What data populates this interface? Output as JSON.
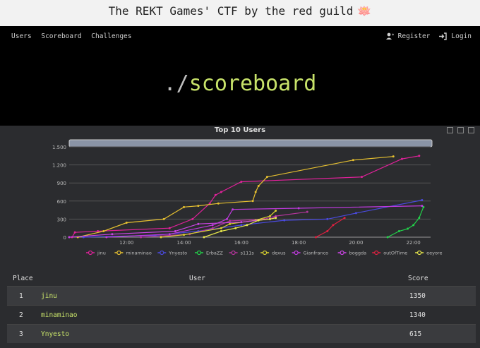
{
  "banner": {
    "title": "The REKT Games' CTF by the red guild",
    "emoji": "🪷"
  },
  "nav": {
    "left": [
      "Users",
      "Scoreboard",
      "Challenges"
    ],
    "register": "Register",
    "login": "Login"
  },
  "hero": {
    "prefix": "./",
    "word": "scoreboard"
  },
  "chart_data": {
    "type": "line",
    "title": "Top 10 Users",
    "xlabel": "",
    "ylabel": "",
    "x_ticks": [
      "12:00",
      "14:00",
      "16:00",
      "18:00",
      "20:00",
      "22:00"
    ],
    "x_range": [
      10.0,
      22.5
    ],
    "ylim": [
      0,
      1500
    ],
    "y_ticks": [
      0,
      300,
      600,
      900,
      "1.200",
      "1.500"
    ],
    "legend_position": "bottom",
    "series": [
      {
        "name": "jinu",
        "color": "#e0219a",
        "points": [
          [
            10.1,
            0
          ],
          [
            10.2,
            80
          ],
          [
            11.0,
            100
          ],
          [
            13.5,
            150
          ],
          [
            14.3,
            300
          ],
          [
            14.9,
            560
          ],
          [
            15.1,
            700
          ],
          [
            15.3,
            750
          ],
          [
            16.0,
            920
          ],
          [
            20.2,
            1000
          ],
          [
            21.6,
            1300
          ],
          [
            22.2,
            1350
          ]
        ]
      },
      {
        "name": "minaminao",
        "color": "#e6c030",
        "points": [
          [
            10.3,
            0
          ],
          [
            11.2,
            100
          ],
          [
            12.0,
            240
          ],
          [
            13.3,
            300
          ],
          [
            14.0,
            500
          ],
          [
            14.5,
            520
          ],
          [
            15.2,
            560
          ],
          [
            16.4,
            600
          ],
          [
            16.5,
            750
          ],
          [
            16.6,
            850
          ],
          [
            16.9,
            1000
          ],
          [
            19.9,
            1280
          ],
          [
            21.3,
            1340
          ]
        ]
      },
      {
        "name": "Ynyesto",
        "color": "#4a4adf",
        "points": [
          [
            10.5,
            0
          ],
          [
            13.0,
            30
          ],
          [
            14.5,
            100
          ],
          [
            16.0,
            200
          ],
          [
            17.5,
            280
          ],
          [
            19.0,
            300
          ],
          [
            20.0,
            400
          ],
          [
            22.3,
            615
          ]
        ]
      },
      {
        "name": "ErbaZZ",
        "color": "#22d34a",
        "points": [
          [
            21.1,
            0
          ],
          [
            21.5,
            100
          ],
          [
            21.8,
            140
          ],
          [
            22.0,
            200
          ],
          [
            22.2,
            320
          ],
          [
            22.35,
            500
          ]
        ]
      },
      {
        "name": "s111s",
        "color": "#b4349c",
        "points": [
          [
            12.5,
            0
          ],
          [
            14.2,
            50
          ],
          [
            15.0,
            150
          ],
          [
            15.6,
            270
          ],
          [
            16.8,
            300
          ],
          [
            17.2,
            350
          ],
          [
            18.3,
            420
          ]
        ]
      },
      {
        "name": "dexus",
        "color": "#d8d030",
        "points": [
          [
            13.2,
            0
          ],
          [
            14.0,
            40
          ],
          [
            15.3,
            150
          ],
          [
            15.6,
            220
          ],
          [
            16.5,
            280
          ],
          [
            17.0,
            350
          ],
          [
            17.2,
            440
          ]
        ]
      },
      {
        "name": "Gianfranco",
        "color": "#c03adf",
        "points": [
          [
            11.3,
            0
          ],
          [
            13.5,
            50
          ],
          [
            15.0,
            200
          ],
          [
            15.5,
            300
          ],
          [
            15.7,
            460
          ],
          [
            18.0,
            480
          ],
          [
            22.3,
            520
          ]
        ]
      },
      {
        "name": "boggda",
        "color": "#cc44e6",
        "points": [
          [
            10.0,
            0
          ],
          [
            11.5,
            50
          ],
          [
            13.7,
            100
          ],
          [
            14.5,
            220
          ],
          [
            16.0,
            250
          ],
          [
            17.0,
            300
          ],
          [
            17.2,
            330
          ]
        ]
      },
      {
        "name": "outOfTime",
        "color": "#e02040",
        "points": [
          [
            18.6,
            0
          ],
          [
            19.0,
            100
          ],
          [
            19.2,
            200
          ],
          [
            19.6,
            320
          ]
        ]
      },
      {
        "name": "eeyore",
        "color": "#e8e84a",
        "points": [
          [
            14.7,
            0
          ],
          [
            15.3,
            100
          ],
          [
            15.8,
            150
          ],
          [
            16.2,
            200
          ],
          [
            16.6,
            280
          ],
          [
            17.0,
            300
          ],
          [
            17.2,
            320
          ]
        ]
      }
    ]
  },
  "table": {
    "headers": {
      "place": "Place",
      "user": "User",
      "score": "Score"
    },
    "rows": [
      {
        "place": "1",
        "user": "jinu",
        "score": "1350"
      },
      {
        "place": "2",
        "user": "minaminao",
        "score": "1340"
      },
      {
        "place": "3",
        "user": "Ynyesto",
        "score": "615"
      }
    ]
  }
}
